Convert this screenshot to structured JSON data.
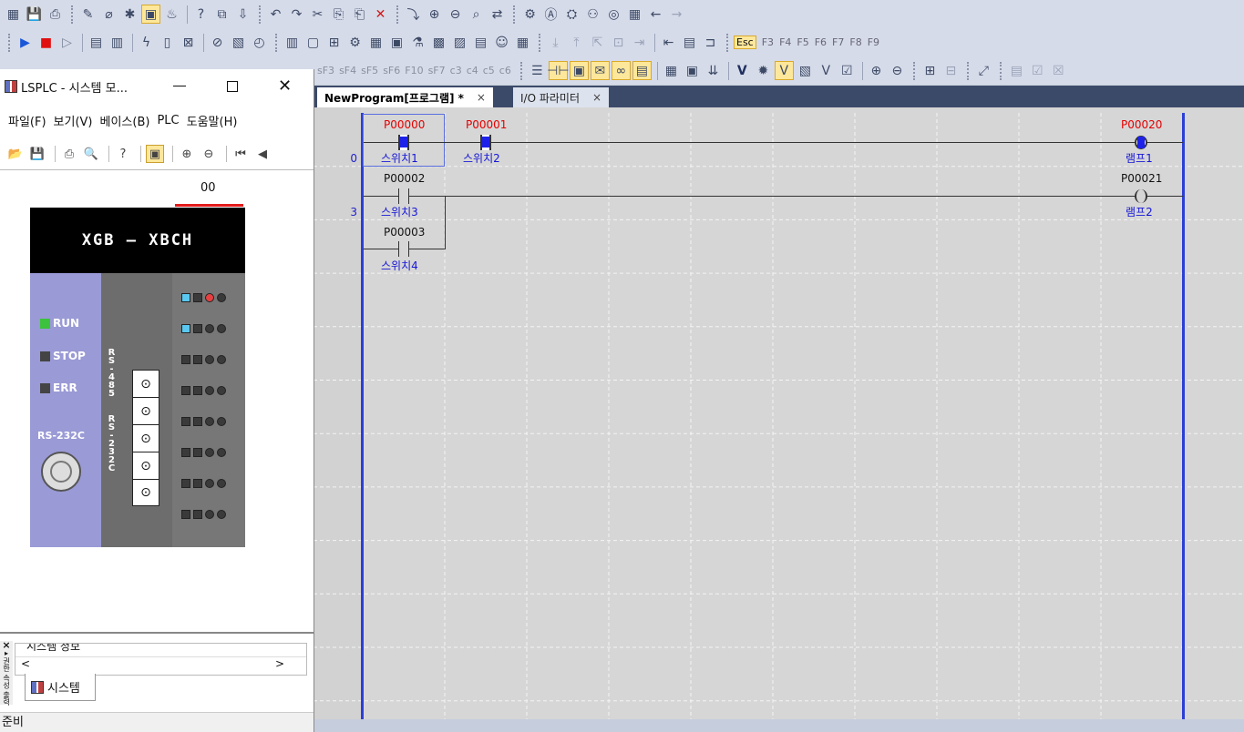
{
  "colors": {
    "accent": "#2b3fd6",
    "active_contact": "#1e22e8",
    "address_red": "#e50000",
    "run_led": "#3cc23c",
    "plc_body": "#9a9ad6"
  },
  "toolbar1": {
    "icons": [
      "new-project-icon",
      "save-icon",
      "print-icon",
      "wrench-icon",
      "link-off-icon",
      "online-icon",
      "monitor-icon",
      "thermometer-icon",
      "help-icon",
      "pages-icon",
      "download-icon",
      "undo-icon",
      "redo-icon",
      "cut-icon",
      "copy-icon",
      "paste-icon",
      "delete-icon",
      "insert-row-icon",
      "insert-contact-icon",
      "delete-contact-icon",
      "find-icon",
      "replace-icon",
      "settings-icon",
      "search-icon",
      "grid-icon",
      "arrow-left-icon",
      "arrow-right-icon"
    ]
  },
  "toolbar2": {
    "fkeys": [
      "Esc",
      "F3",
      "F4",
      "F5",
      "F6",
      "F7",
      "F8",
      "F9"
    ]
  },
  "toolbar3": {
    "dim_labels": [
      "sF3",
      "sF4",
      "sF5",
      "sF6",
      "F10",
      "sF7",
      "c3",
      "c4",
      "c5",
      "c6"
    ],
    "text_v": "V"
  },
  "tabs": [
    {
      "label": "NewProgram[프로그램] *",
      "close": "×"
    },
    {
      "label": "I/O 파라미터",
      "close": "×"
    }
  ],
  "ladder": {
    "row_numbers": [
      "0",
      "3"
    ],
    "contacts": [
      {
        "address": "P00000",
        "name": "스위치1",
        "active": true
      },
      {
        "address": "P00001",
        "name": "스위치2",
        "active": true
      },
      {
        "address": "P00002",
        "name": "스위치3",
        "active": false
      },
      {
        "address": "P00003",
        "name": "스위치4",
        "active": false
      }
    ],
    "coils": [
      {
        "address": "P00020",
        "name": "램프1",
        "active": true
      },
      {
        "address": "P00021",
        "name": "램프2",
        "active": false
      }
    ]
  },
  "panel": {
    "title": "LSPLC - 시스템 모...",
    "menu": [
      "파일(F)",
      "보기(V)",
      "베이스(B)",
      "PLC",
      "도움말(H)"
    ],
    "slot_label": "00",
    "plc_model": "XGB — XBCH",
    "leds": [
      {
        "label": "RUN",
        "color": "#3cc23c"
      },
      {
        "label": "STOP",
        "color": "#444"
      },
      {
        "label": "ERR",
        "color": "#444"
      }
    ],
    "port_rs485": "RS-485",
    "port_rs232": "RS-232C",
    "port_rs232c_left": "RS-232C",
    "bottom_partial": "시스템 정보",
    "bottom_tab": "시스템",
    "side_strip": "권한 속성 출력",
    "status": "준비"
  }
}
